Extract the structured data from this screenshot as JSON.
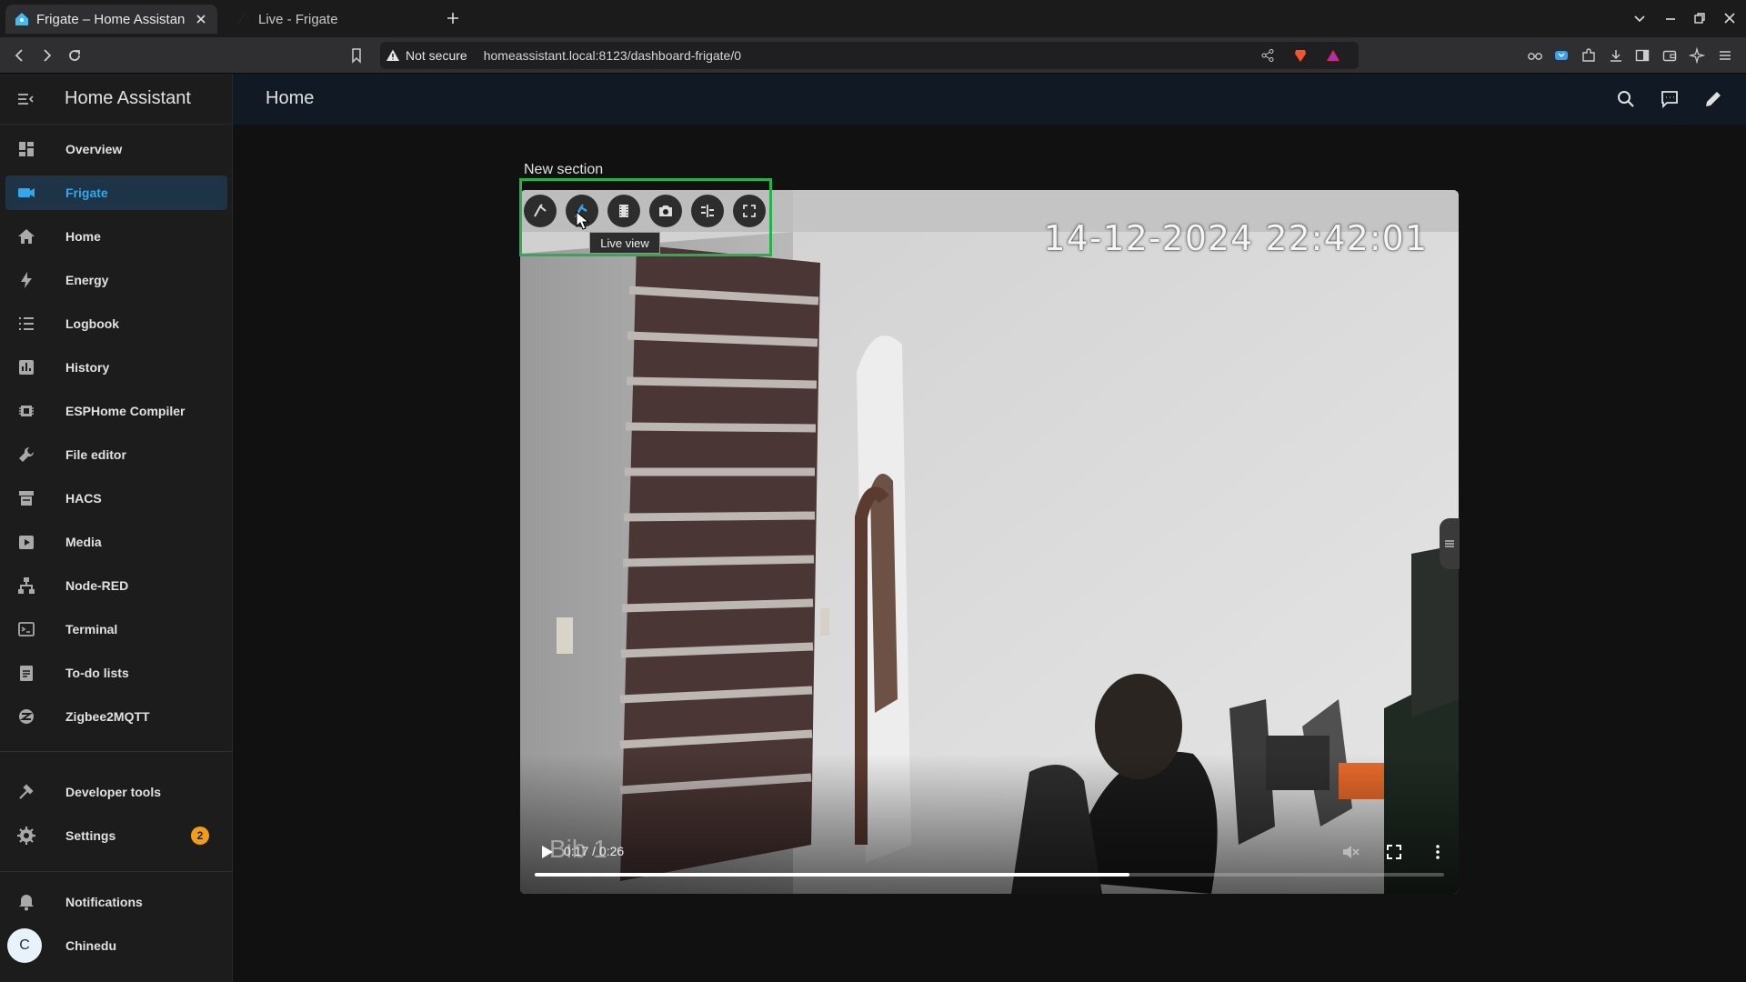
{
  "browser": {
    "tabs": [
      {
        "title": "Frigate – Home Assistan",
        "active": true
      },
      {
        "title": "Live - Frigate",
        "active": false
      }
    ],
    "address": {
      "security_label": "Not secure",
      "url": "homeassistant.local:8123/dashboard-frigate/0"
    }
  },
  "sidebar": {
    "title": "Home Assistant",
    "items": [
      {
        "label": "Overview",
        "icon": "dashboard-icon"
      },
      {
        "label": "Frigate",
        "icon": "video-camera-icon",
        "selected": true
      },
      {
        "label": "Home",
        "icon": "home-icon"
      },
      {
        "label": "Energy",
        "icon": "lightning-bolt-icon"
      },
      {
        "label": "Logbook",
        "icon": "list-icon"
      },
      {
        "label": "History",
        "icon": "chart-bar-icon"
      },
      {
        "label": "ESPHome Compiler",
        "icon": "chip-icon"
      },
      {
        "label": "File editor",
        "icon": "wrench-icon"
      },
      {
        "label": "HACS",
        "icon": "store-icon"
      },
      {
        "label": "Media",
        "icon": "play-box-icon"
      },
      {
        "label": "Node-RED",
        "icon": "sitemap-icon"
      },
      {
        "label": "Terminal",
        "icon": "console-icon"
      },
      {
        "label": "To-do lists",
        "icon": "clipboard-list-icon"
      },
      {
        "label": "Zigbee2MQTT",
        "icon": "zigbee-icon"
      }
    ],
    "bottom_items": [
      {
        "label": "Developer tools",
        "icon": "hammer-icon"
      },
      {
        "label": "Settings",
        "icon": "cog-icon",
        "badge": "2"
      }
    ],
    "notifications_label": "Notifications",
    "user": {
      "name": "Chinedu",
      "initial": "C"
    }
  },
  "topbar": {
    "title": "Home"
  },
  "section": {
    "title": "New section"
  },
  "camera": {
    "timestamp": "14-12-2024 22:42:01",
    "overlay_name": "Bib 1",
    "tooltip": "Live view",
    "controls": [
      "frigate-menu-icon",
      "live-view-icon",
      "clips-icon",
      "snapshot-icon",
      "timeline-icon",
      "fullscreen-icon"
    ],
    "video": {
      "time": "0:17 / 0:26",
      "progress": 0.654
    }
  },
  "colors": {
    "accent": "#33a7e9",
    "selected_bg": "#1c3446",
    "highlight_border": "#25b24a",
    "badge": "#f19d1a"
  }
}
